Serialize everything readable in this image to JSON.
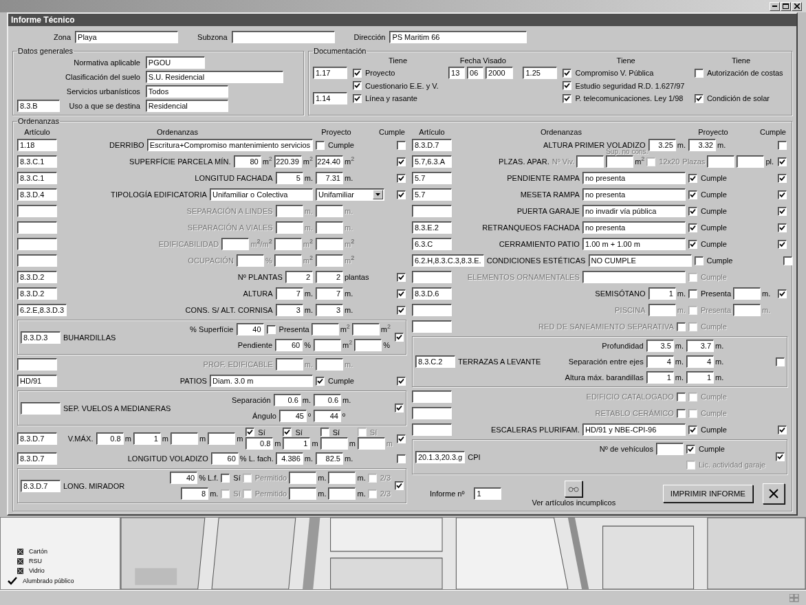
{
  "dialog": {
    "title": "Informe Técnico"
  },
  "location": [
    {
      "label": "Zona",
      "value": "Playa"
    },
    {
      "label": "Subzona"
    },
    {
      "label": "Dirección",
      "value": "PS Maritim 66"
    }
  ],
  "datos_generales": {
    "title": "Datos generales",
    "rows": [
      {
        "label": "Normativa aplicable",
        "value": "PGOU"
      },
      {
        "label": "Clasificación del suelo",
        "value": "S.U. Residencial"
      },
      {
        "label": "Servicios urbanísticos",
        "value": "Todos"
      },
      {
        "article": "8.3.B",
        "label": "Uso a que se destina",
        "value": "Residencial"
      }
    ]
  },
  "documentacion": {
    "title": "Documentación",
    "headers": [
      "Tiene",
      "Fecha Visado",
      "Tiene",
      "Tiene"
    ],
    "rows": [
      {
        "article": "1.17",
        "tiene": {
          "label": "Proyecto",
          "checked": true
        },
        "fecha": [
          "13",
          "06",
          "2000"
        ],
        "article_2": "1.25",
        "tiene_2": {
          "label": "Compromiso V. Pública",
          "checked": true
        },
        "tiene_3": {
          "label": "Autorización de costas",
          "checked": false
        }
      },
      {
        "tiene": {
          "label": "Cuestionario E.E. y V.",
          "checked": true
        },
        "tiene_2": {
          "label": "Estudio seguridad R.D. 1.627/97",
          "checked": true
        }
      },
      {
        "article": "1.14",
        "tiene": {
          "label": "Línea y rasante",
          "checked": true
        },
        "tiene_2": {
          "label": "P. telecomunicaciones. Ley 1/98",
          "checked": true
        },
        "tiene_3": {
          "label": "Condición de solar",
          "checked": true
        }
      }
    ]
  },
  "ordenanzas": {
    "title": "Ordenanzas",
    "left": {
      "headers": [
        "Artículo",
        "Ordenanzas",
        "Proyecto",
        "Cumple"
      ],
      "rows": [
        {
          "kind": "row",
          "article": "1.18",
          "label": "DERRIBO",
          "disabled": false,
          "ord": [
            {
              "kind": "text",
              "value": "Escritura+Compromiso mantenimiento servicios"
            }
          ],
          "proy": [
            {
              "kind": "check",
              "label": "Cumple",
              "checked": false,
              "disabled": false
            }
          ],
          "cumple": false
        },
        {
          "kind": "row",
          "article": "8.3.C.1",
          "label": "SUPERFÍCIE PARCELA MÍN.",
          "disabled": false,
          "ord": [
            {
              "kind": "number",
              "value": "80",
              "unit": "m$^{2}$"
            },
            {
              "kind": "number",
              "value": "220.39",
              "unit": "m$^{2}$"
            }
          ],
          "proy": [
            {
              "kind": "number",
              "value": "224.40",
              "unit": "m$^{2}$"
            }
          ],
          "cumple": true
        },
        {
          "kind": "row",
          "article": "8.3.C.1",
          "label": "LONGITUD FACHADA",
          "disabled": false,
          "ord": [
            {
              "kind": "number",
              "value": "5",
              "unit": "m."
            }
          ],
          "proy": [
            {
              "kind": "number",
              "value": "7.31",
              "unit": "m."
            }
          ],
          "cumple": true
        },
        {
          "kind": "row",
          "article": "8.3.D.4",
          "label": "TIPOLOGÍA EDIFICATORIA",
          "disabled": false,
          "ord": [
            {
              "kind": "text",
              "value": "Unifamiliar o Colectiva"
            }
          ],
          "proy": [
            {
              "kind": "combo",
              "value": "Unifamiliar"
            }
          ],
          "cumple": true
        },
        {
          "kind": "row",
          "label": "SEPARACIÓN A LINDES",
          "disabled": true,
          "ord": [
            {
              "kind": "number",
              "unit": "m."
            }
          ],
          "proy": [
            {
              "kind": "number",
              "unit": "m."
            }
          ]
        },
        {
          "kind": "row",
          "label": "SEPARACIÓN A VIALES",
          "disabled": true,
          "ord": [
            {
              "kind": "number",
              "unit": "m."
            }
          ],
          "proy": [
            {
              "kind": "number",
              "unit": "m."
            }
          ]
        },
        {
          "kind": "row",
          "label": "EDIFICABILIDAD",
          "disabled": true,
          "ord": [
            {
              "kind": "number",
              "unit": "m$^{2}$/m$^{2}$"
            },
            {
              "kind": "number",
              "unit": "m$^{2}$"
            }
          ],
          "proy": [
            {
              "kind": "number",
              "unit": "m$^{2}$"
            }
          ]
        },
        {
          "kind": "row",
          "label": "OCUPACIÓN",
          "disabled": true,
          "ord": [
            {
              "kind": "number",
              "unit": "%"
            },
            {
              "kind": "number",
              "unit": "m$^{2}$"
            }
          ],
          "proy": [
            {
              "kind": "number",
              "unit": "m$^{2}$"
            }
          ]
        },
        {
          "kind": "row",
          "article": "8.3.D.2",
          "label": "Nº PLANTAS",
          "disabled": false,
          "ord": [
            {
              "kind": "number",
              "value": "2"
            }
          ],
          "proy": [
            {
              "kind": "number",
              "value": "2",
              "unit": "plantas"
            }
          ],
          "cumple": true
        },
        {
          "kind": "row",
          "article": "8.3.D.2",
          "label": "ALTURA",
          "disabled": false,
          "ord": [
            {
              "kind": "number",
              "value": "7",
              "unit": "m."
            }
          ],
          "proy": [
            {
              "kind": "number",
              "value": "7",
              "unit": "m."
            }
          ],
          "cumple": true
        },
        {
          "kind": "row",
          "article": "6.2.E,8.3.D.3",
          "label": "CONS. S/ ALT. CORNISA",
          "disabled": false,
          "ord": [
            {
              "kind": "number",
              "value": "3",
              "unit": "m."
            }
          ],
          "proy": [
            {
              "kind": "number",
              "value": "3",
              "unit": "m."
            }
          ],
          "cumple": true
        },
        {
          "kind": "group",
          "article": "8.3.D.3",
          "title": "BUHARDILLAS",
          "lines": [
            {
              "label": "% Superfície",
              "ord": [
                {
                  "kind": "number",
                  "value": "40"
                }
              ],
              "proy": [
                {
                  "kind": "check",
                  "label": "Presenta",
                  "checked": false,
                  "disabled": false
                },
                {
                  "kind": "number",
                  "unit": "m$^{2}$"
                },
                {
                  "kind": "number",
                  "unit": "m$^{2}$"
                }
              ]
            },
            {
              "label": "Pendiente",
              "ord": [
                {
                  "kind": "number",
                  "value": "60",
                  "unit": "%"
                }
              ],
              "proy": [
                {
                  "kind": "number",
                  "unit": "m$^{2}$"
                },
                {
                  "kind": "number",
                  "unit": "%"
                }
              ]
            }
          ],
          "cumple": true
        },
        {
          "kind": "row",
          "label": "PROF. EDIFICABLE",
          "disabled": true,
          "ord": [
            {
              "kind": "number",
              "unit": "m."
            }
          ],
          "proy": [
            {
              "kind": "number",
              "unit": "m."
            }
          ]
        },
        {
          "kind": "row",
          "article": "HD/91",
          "label": "PATIOS",
          "disabled": false,
          "ord": [
            {
              "kind": "text",
              "value": "Diam. 3.0 m"
            }
          ],
          "proy": [
            {
              "kind": "check",
              "label": "Cumple",
              "checked": true,
              "disabled": false
            }
          ],
          "cumple": true
        },
        {
          "kind": "group",
          "title": "SEP. VUELOS A MEDIANERAS",
          "lines": [
            {
              "label": "Separación",
              "ord": [
                {
                  "kind": "number",
                  "value": "0.6",
                  "unit": "m."
                }
              ],
              "proy": [
                {
                  "kind": "number",
                  "value": "0.6",
                  "unit": "m."
                }
              ]
            },
            {
              "label": "Ángulo",
              "ord": [
                {
                  "kind": "number",
                  "value": "45",
                  "unit": "º"
                }
              ],
              "proy": [
                {
                  "kind": "number",
                  "value": "44",
                  "unit": "º"
                }
              ]
            }
          ],
          "cumple": true
        },
        {
          "kind": "row",
          "article": "8.3.D.7",
          "label": "V.MÁX.",
          "disabled": false,
          "ord": [
            {
              "kind": "number",
              "value": "0.8",
              "unit": "m"
            },
            {
              "kind": "number",
              "value": "1",
              "unit": "m"
            },
            {
              "kind": "number",
              "unit": "m"
            },
            {
              "kind": "number",
              "unit": "m"
            }
          ],
          "proy": [
            {
              "kind": "option",
              "label": "Sí",
              "checked": true,
              "disabled": false,
              "value": "0.8",
              "unit": "m"
            },
            {
              "kind": "option",
              "label": "Sí",
              "checked": true,
              "disabled": false,
              "value": "1",
              "unit": "m"
            },
            {
              "kind": "option",
              "label": "Sí",
              "checked": false,
              "disabled": false,
              "unit": "m"
            },
            {
              "kind": "option",
              "label": "Sí",
              "checked": false,
              "disabled": true,
              "unit": "m"
            }
          ],
          "cumple": true
        },
        {
          "kind": "row",
          "article": "8.3.D.7",
          "label": "LONGITUD VOLADIZO",
          "disabled": false,
          "ord": [
            {
              "kind": "number",
              "value": "60",
              "unit": "% L. fach."
            },
            {
              "kind": "number",
              "value": "4.386",
              "unit": "m."
            }
          ],
          "proy": [
            {
              "kind": "number",
              "value": "82.5",
              "unit": "m."
            }
          ],
          "cumple": false
        },
        {
          "kind": "group",
          "article": "8.3.D.7",
          "title": "LONG. MIRADOR",
          "lines": [
            {
              "ord": [
                {
                  "kind": "number",
                  "value": "40",
                  "unit": "% L.f."
                }
              ],
              "proy": [
                {
                  "kind": "check",
                  "label": "Sí",
                  "checked": false,
                  "disabled": false
                },
                {
                  "kind": "check",
                  "label": "Permitido",
                  "checked": false,
                  "disabled": true
                },
                {
                  "kind": "number",
                  "unit": "m."
                },
                {
                  "kind": "number",
                  "unit": "m."
                },
                {
                  "kind": "check",
                  "label": "2/3",
                  "checked": false,
                  "disabled": true
                }
              ]
            },
            {
              "ord": [
                {
                  "kind": "number",
                  "value": "8",
                  "unit": "m."
                }
              ],
              "proy": [
                {
                  "kind": "check",
                  "label": "Sí",
                  "checked": false,
                  "disabled": true
                },
                {
                  "kind": "check",
                  "label": "Permitido",
                  "checked": false,
                  "disabled": true
                },
                {
                  "kind": "number",
                  "unit": "m."
                },
                {
                  "kind": "number",
                  "unit": "m."
                },
                {
                  "kind": "check",
                  "label": "2/3",
                  "checked": false,
                  "disabled": true
                }
              ]
            }
          ],
          "cumple": true
        }
      ]
    },
    "right": {
      "headers": [
        "Artículo",
        "Ordenanzas",
        "Proyecto",
        "Cumple"
      ],
      "rows": [
        {
          "kind": "row",
          "article": "8.3.D.7",
          "label": "ALTURA PRIMER VOLADIZO",
          "disabled": false,
          "ord": [
            {
              "kind": "number",
              "value": "3.25",
              "unit": "m."
            }
          ],
          "proy": [
            {
              "kind": "number",
              "value": "3.32",
              "unit": "m."
            }
          ],
          "cumple": false
        },
        {
          "kind": "row",
          "article": "5.7,6.3.A",
          "label": "PLZAS. APAR.",
          "disabled": false,
          "ord": [
            {
              "kind": "caption",
              "text": "Nº Viv."
            },
            {
              "kind": "number"
            },
            {
              "kind": "number",
              "caption": "Sup. no cons.",
              "unit": "m$^{2}$"
            },
            {
              "kind": "check",
              "label": "12x20",
              "checked": false,
              "disabled": true
            }
          ],
          "proy": [
            {
              "kind": "caption",
              "text": "Plazas"
            },
            {
              "kind": "number"
            },
            {
              "kind": "number",
              "unit": "pl."
            }
          ],
          "cumple": true
        },
        {
          "kind": "row",
          "article": "5.7",
          "label": "PENDIENTE RAMPA",
          "disabled": false,
          "ord": [
            {
              "kind": "text",
              "value": "no presenta"
            }
          ],
          "proy": [
            {
              "kind": "check",
              "label": "Cumple",
              "checked": true,
              "disabled": false
            }
          ],
          "cumple": true
        },
        {
          "kind": "row",
          "article": "5.7",
          "label": "MESETA RAMPA",
          "disabled": false,
          "ord": [
            {
              "kind": "text",
              "value": "no presenta"
            }
          ],
          "proy": [
            {
              "kind": "check",
              "label": "Cumple",
              "checked": true,
              "disabled": false
            }
          ],
          "cumple": true
        },
        {
          "kind": "row",
          "label": "PUERTA GARAJE",
          "disabled": false,
          "ord": [
            {
              "kind": "text",
              "value": "no invadir vía pública"
            }
          ],
          "proy": [
            {
              "kind": "check",
              "label": "Cumple",
              "checked": true,
              "disabled": false
            }
          ],
          "cumple": true
        },
        {
          "kind": "row",
          "article": "8.3.E.2",
          "label": "RETRANQUEOS FACHADA",
          "disabled": false,
          "ord": [
            {
              "kind": "text",
              "value": "no presenta"
            }
          ],
          "proy": [
            {
              "kind": "check",
              "label": "Cumple",
              "checked": true,
              "disabled": false
            }
          ],
          "cumple": true
        },
        {
          "kind": "row",
          "article": "6.3.C",
          "label": "CERRAMIENTO PATIO",
          "disabled": false,
          "ord": [
            {
              "kind": "text",
              "value": "1.00 m + 1.00 m"
            }
          ],
          "proy": [
            {
              "kind": "check",
              "label": "Cumple",
              "checked": true,
              "disabled": false
            }
          ],
          "cumple": true
        },
        {
          "kind": "row",
          "article": "6.2.H,8.3.C.3,8.3.E.",
          "label": "CONDICIONES ESTÉTICAS",
          "disabled": false,
          "ord": [
            {
              "kind": "text",
              "value": "NO CUMPLE"
            }
          ],
          "proy": [
            {
              "kind": "check",
              "label": "Cumple",
              "checked": false,
              "disabled": false
            }
          ],
          "cumple": false
        },
        {
          "kind": "row",
          "label": "ELEMENTOS ORNAMENTALES",
          "disabled": true,
          "ord": [
            {
              "kind": "text"
            }
          ],
          "proy": [
            {
              "kind": "check",
              "label": "Cumple",
              "checked": false,
              "disabled": true
            }
          ]
        },
        {
          "kind": "row",
          "article": "8.3.D.6",
          "label": "SEMISÓTANO",
          "disabled": false,
          "ord": [
            {
              "kind": "number",
              "value": "1",
              "unit": "m."
            }
          ],
          "proy": [
            {
              "kind": "check",
              "label": "Presenta",
              "checked": false,
              "disabled": false
            },
            {
              "kind": "number",
              "unit": "m."
            }
          ],
          "cumple": true
        },
        {
          "kind": "row",
          "label": "PISCINA",
          "disabled": true,
          "ord": [
            {
              "kind": "number",
              "unit": "m."
            }
          ],
          "proy": [
            {
              "kind": "check",
              "label": "Presenta",
              "checked": false,
              "disabled": true
            },
            {
              "kind": "number",
              "unit": "m."
            }
          ]
        },
        {
          "kind": "row",
          "label": "RED DE SANEAMIENTO SEPARATIVA",
          "disabled": true,
          "ord": [
            {
              "kind": "check",
              "checked": false,
              "disabled": false
            }
          ],
          "proy": [
            {
              "kind": "check",
              "label": "Cumple",
              "checked": false,
              "disabled": true
            }
          ]
        },
        {
          "kind": "group",
          "article": "8.3.C.2",
          "title": "TERRAZAS A LEVANTE",
          "lines": [
            {
              "label": "Profundidad",
              "ord": [
                {
                  "kind": "number",
                  "value": "3.5",
                  "unit": "m."
                }
              ],
              "proy": [
                {
                  "kind": "number",
                  "value": "3.7",
                  "unit": "m."
                }
              ]
            },
            {
              "label": "Separación entre ejes",
              "ord": [
                {
                  "kind": "number",
                  "value": "4",
                  "unit": "m."
                }
              ],
              "proy": [
                {
                  "kind": "number",
                  "value": "4",
                  "unit": "m."
                }
              ]
            },
            {
              "label": "Altura máx. barandillas",
              "ord": [
                {
                  "kind": "number",
                  "value": "1",
                  "unit": "m."
                }
              ],
              "proy": [
                {
                  "kind": "number",
                  "value": "1",
                  "unit": "m."
                }
              ]
            }
          ],
          "cumple": false
        },
        {
          "kind": "row",
          "label": "EDIFICIO CATALOGADO",
          "disabled": true,
          "ord": [
            {
              "kind": "check",
              "checked": false,
              "disabled": false
            }
          ],
          "proy": [
            {
              "kind": "check",
              "label": "Cumple",
              "checked": false,
              "disabled": true
            }
          ]
        },
        {
          "kind": "row",
          "label": "RETABLO CERÁMICO",
          "disabled": true,
          "ord": [
            {
              "kind": "check",
              "checked": false,
              "disabled": false
            }
          ],
          "proy": [
            {
              "kind": "check",
              "label": "Cumple",
              "checked": false,
              "disabled": true
            }
          ]
        },
        {
          "kind": "row",
          "label": "ESCALERAS PLURIFAM.",
          "disabled": false,
          "ord": [
            {
              "kind": "text",
              "value": "HD/91 y NBE-CPI-96"
            }
          ],
          "proy": [
            {
              "kind": "check",
              "label": "Cumple",
              "checked": true,
              "disabled": false
            }
          ],
          "cumple": true
        },
        {
          "kind": "group",
          "article": "20.1.3,20.3.g",
          "title": "CPI",
          "lines": [
            {
              "label": "Nº de vehículos",
              "ord": [
                {
                  "kind": "number"
                }
              ],
              "proy": [
                {
                  "kind": "check",
                  "label": "Cumple",
                  "checked": true,
                  "disabled": false
                }
              ]
            },
            {
              "proy": [
                {
                  "kind": "check",
                  "label": "Lic. actividad garaje",
                  "checked": false,
                  "disabled": true
                }
              ]
            }
          ],
          "cumple": true
        }
      ]
    }
  },
  "footer": {
    "informe_label": "Informe nº",
    "informe_value": "1",
    "view_caption": "Ver artículos incumplicos",
    "print_button": "IMPRIMIR INFORME"
  },
  "legend": [
    {
      "kind": "box",
      "label": "Cartón"
    },
    {
      "kind": "box",
      "label": "RSU"
    },
    {
      "kind": "box",
      "label": "Vidrio"
    },
    {
      "kind": "check",
      "label": "Alumbrado público"
    }
  ]
}
